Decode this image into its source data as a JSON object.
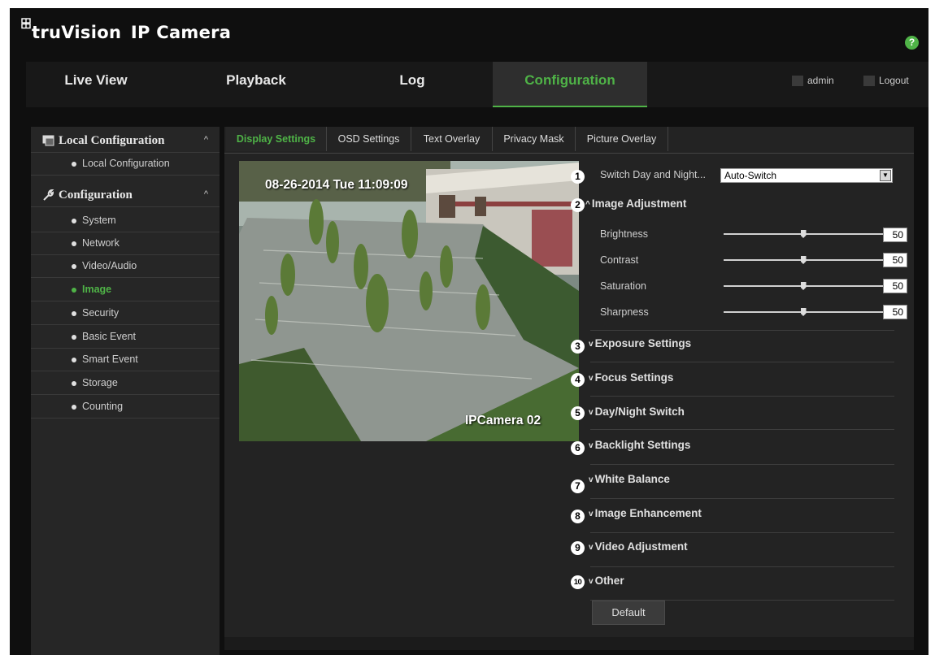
{
  "app": {
    "logo_prefix": "truVision",
    "logo_suffix": "IP Camera",
    "help_label": "?"
  },
  "nav": {
    "tabs": [
      {
        "label": "Live View"
      },
      {
        "label": "Playback"
      },
      {
        "label": "Log"
      },
      {
        "label": "Configuration",
        "active": true
      }
    ],
    "user": "admin",
    "logout": "Logout"
  },
  "sidebar": {
    "groups": [
      {
        "label": "Local Configuration",
        "caret": "^",
        "items": [
          {
            "label": "Local Configuration"
          }
        ]
      },
      {
        "label": "Configuration",
        "caret": "^",
        "items": [
          {
            "label": "System"
          },
          {
            "label": "Network"
          },
          {
            "label": "Video/Audio"
          },
          {
            "label": "Image",
            "active": true
          },
          {
            "label": "Security"
          },
          {
            "label": "Basic Event"
          },
          {
            "label": "Smart Event"
          },
          {
            "label": "Storage"
          },
          {
            "label": "Counting"
          }
        ]
      }
    ]
  },
  "subtabs": [
    {
      "label": "Display Settings",
      "active": true
    },
    {
      "label": "OSD Settings"
    },
    {
      "label": "Text Overlay"
    },
    {
      "label": "Privacy Mask"
    },
    {
      "label": "Picture Overlay"
    }
  ],
  "preview": {
    "osd_datetime": "08-26-2014 Tue 11:09:09",
    "osd_camera_name": "IPCamera 02"
  },
  "settings": {
    "switch_label": "Switch Day and Night...",
    "switch_value": "Auto-Switch",
    "sections": [
      {
        "num": "1"
      },
      {
        "num": "2",
        "chevron": "^",
        "title": "Image Adjustment"
      },
      {
        "num": "3",
        "chevron": "v",
        "title": "Exposure Settings"
      },
      {
        "num": "4",
        "chevron": "v",
        "title": "Focus Settings"
      },
      {
        "num": "5",
        "chevron": "v",
        "title": "Day/Night Switch"
      },
      {
        "num": "6",
        "chevron": "v",
        "title": "Backlight Settings"
      },
      {
        "num": "7",
        "chevron": "v",
        "title": "White Balance"
      },
      {
        "num": "8",
        "chevron": "v",
        "title": "Image Enhancement"
      },
      {
        "num": "9",
        "chevron": "v",
        "title": "Video Adjustment"
      },
      {
        "num": "10",
        "chevron": "v",
        "title": "Other"
      }
    ],
    "sliders": [
      {
        "label": "Brightness",
        "value": "50",
        "fraction": 0.5
      },
      {
        "label": "Contrast",
        "value": "50",
        "fraction": 0.5
      },
      {
        "label": "Saturation",
        "value": "50",
        "fraction": 0.5
      },
      {
        "label": "Sharpness",
        "value": "50",
        "fraction": 0.5
      }
    ],
    "default_button": "Default"
  },
  "colors": {
    "accent": "#4fb347",
    "background": "#0f0f0f",
    "panel": "#232323"
  }
}
